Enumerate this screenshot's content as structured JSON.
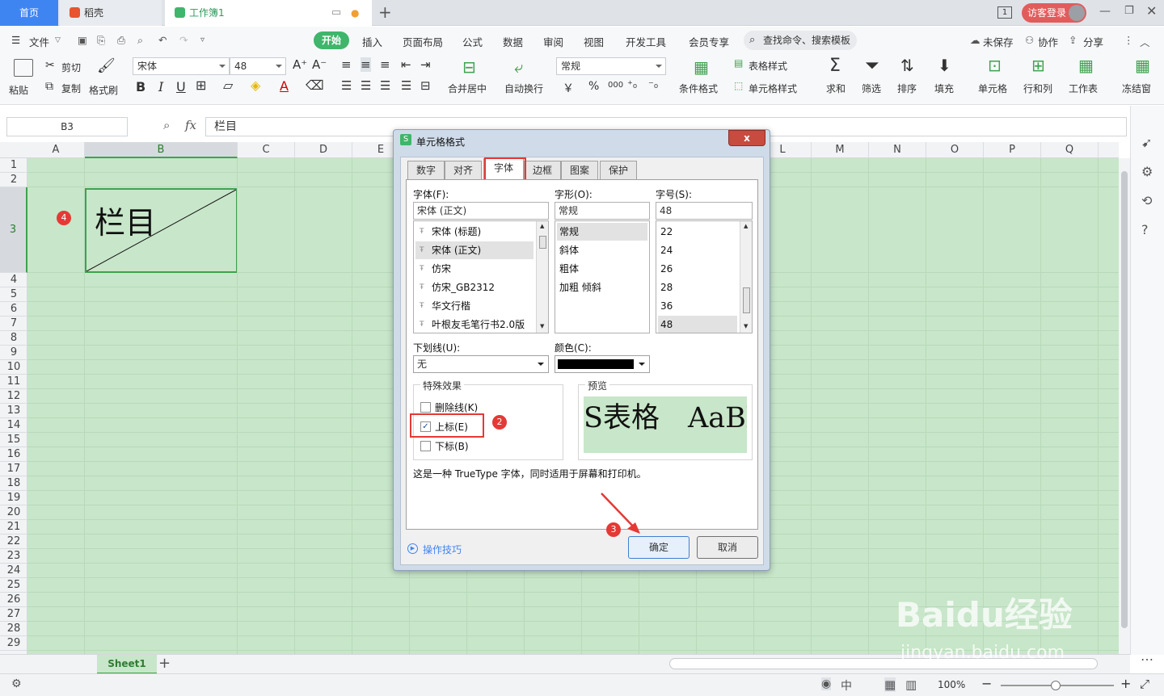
{
  "tabs": {
    "home": "首页",
    "daoke": "稻壳",
    "workbook": "工作簿1",
    "page_count": "1",
    "login": "访客登录"
  },
  "menu": {
    "file": "文件",
    "items": [
      "开始",
      "插入",
      "页面布局",
      "公式",
      "数据",
      "审阅",
      "视图",
      "开发工具",
      "会员专享"
    ],
    "search": "查找命令、搜索模板",
    "unsaved": "未保存",
    "collab": "协作",
    "share": "分享"
  },
  "ribbon": {
    "paste": "粘贴",
    "cut": "剪切",
    "copy": "复制",
    "format_painter": "格式刷",
    "font": "宋体",
    "size": "48",
    "bold": "B",
    "italic": "I",
    "underline": "U",
    "font_color": "A",
    "merge": "合并居中",
    "wrap": "自动换行",
    "number_format": "常规",
    "currency": "￥",
    "percent": "%",
    "thousands": "000",
    "cond_format": "条件格式",
    "table_style": "表格样式",
    "cell_style": "单元格样式",
    "sum": "求和",
    "filter": "筛选",
    "sort": "排序",
    "fill": "填充",
    "cell": "单元格",
    "rowcol": "行和列",
    "worksheet": "工作表",
    "freeze": "冻结窗"
  },
  "formula_bar": {
    "name_box": "B3",
    "fx": "fx",
    "value": "栏目"
  },
  "columns": [
    "A",
    "B",
    "C",
    "D",
    "E",
    "F",
    "G",
    "H",
    "I",
    "J",
    "K",
    "L",
    "M",
    "N",
    "O",
    "P",
    "Q"
  ],
  "rows": [
    "1",
    "2",
    "3",
    "4",
    "5",
    "6",
    "7",
    "8",
    "9",
    "10",
    "11",
    "12",
    "13",
    "14",
    "15",
    "16",
    "17",
    "18",
    "19",
    "20",
    "21",
    "22",
    "23",
    "24",
    "25",
    "26",
    "27",
    "28",
    "29"
  ],
  "cell_b3": "栏目",
  "dialog": {
    "title": "单元格格式",
    "close": "x",
    "tabs": [
      "数字",
      "对齐",
      "字体",
      "边框",
      "图案",
      "保护"
    ],
    "active_tab": "字体",
    "font_label": "字体(F):",
    "font_value": "宋体 (正文)",
    "font_list": [
      "宋体 (标题)",
      "宋体 (正文)",
      "仿宋",
      "仿宋_GB2312",
      "华文行楷",
      "叶根友毛笔行书2.0版"
    ],
    "style_label": "字形(O):",
    "style_value": "常规",
    "style_list": [
      "常规",
      "斜体",
      "粗体",
      "加粗 倾斜"
    ],
    "size_label": "字号(S):",
    "size_value": "48",
    "size_list": [
      "22",
      "24",
      "26",
      "28",
      "36",
      "48"
    ],
    "underline_label": "下划线(U):",
    "underline_value": "无",
    "color_label": "颜色(C):",
    "effects_label": "特殊效果",
    "strikethrough": "删除线(K)",
    "superscript": "上标(E)",
    "subscript": "下标(B)",
    "preview_label": "预览",
    "preview_text": "S表格　AaBl",
    "note": "这是一种 TrueType 字体，同时适用于屏幕和打印机。",
    "tips": "操作技巧",
    "ok": "确定",
    "cancel": "取消"
  },
  "badges": [
    "1",
    "2",
    "3",
    "4"
  ],
  "sheet_tab": "Sheet1",
  "status": {
    "zoom": "100%"
  },
  "watermark": {
    "brand": "Baidu经验",
    "url": "jingyan.baidu.com"
  },
  "colors": {
    "accent": "#3fb66b",
    "home_tab": "#3f85f2",
    "cell_fill": "#c8e6c9",
    "highlight": "#e53935"
  }
}
